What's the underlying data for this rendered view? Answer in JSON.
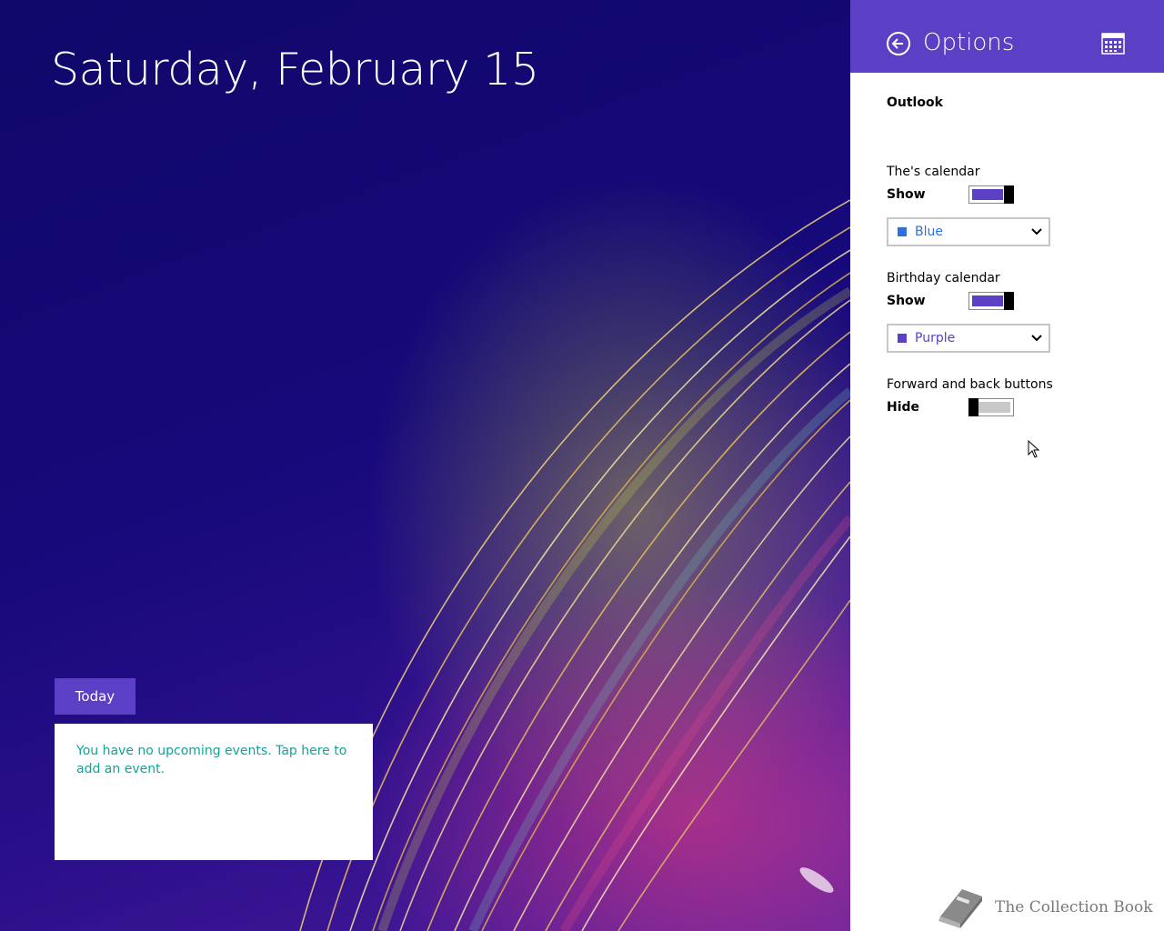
{
  "background": {
    "date_heading": "Saturday, February 15"
  },
  "agenda": {
    "today_label": "Today",
    "empty_message": "You have no upcoming events. Tap here to add an event."
  },
  "options": {
    "title": "Options",
    "account": "Outlook",
    "calendars": [
      {
        "label": "The's calendar",
        "state": "Show",
        "on": true,
        "color_name": "Blue",
        "color": "#2f6fe0"
      },
      {
        "label": "Birthday calendar",
        "state": "Show",
        "on": true,
        "color_name": "Purple",
        "color": "#5b3fc4"
      }
    ],
    "nav_buttons": {
      "label": "Forward and back buttons",
      "state": "Hide",
      "on": false
    }
  },
  "theme": {
    "accent": "#5b3fc4",
    "link": "#12a39a"
  },
  "watermark": {
    "text": "The Collection Book"
  }
}
